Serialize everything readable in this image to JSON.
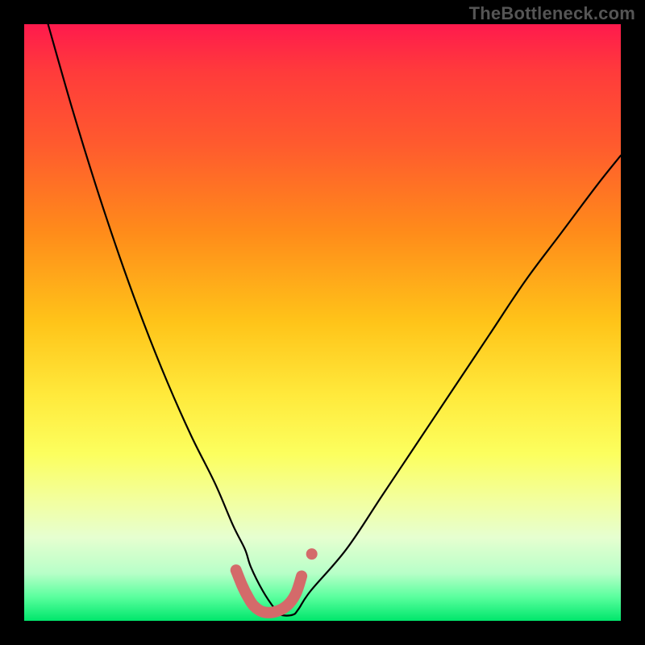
{
  "watermark": "TheBottleneck.com",
  "chart_data": {
    "type": "line",
    "title": "",
    "xlabel": "",
    "ylabel": "",
    "xlim": [
      0,
      100
    ],
    "ylim": [
      0,
      100
    ],
    "grid": false,
    "axes_shown": false,
    "legend": null,
    "annotations": [],
    "background_gradient": {
      "direction": "top-to-bottom",
      "stops": [
        {
          "pos": 0.0,
          "color": "#ff1a4d"
        },
        {
          "pos": 0.35,
          "color": "#ff8c1a"
        },
        {
          "pos": 0.62,
          "color": "#ffe93b"
        },
        {
          "pos": 0.86,
          "color": "#e6ffd0"
        },
        {
          "pos": 1.0,
          "color": "#00e66b"
        }
      ]
    },
    "series": [
      {
        "name": "bottleneck-curve",
        "stroke": "#000000",
        "x": [
          4,
          8,
          12,
          16,
          20,
          24,
          28,
          32,
          35,
          37,
          38,
          40,
          42,
          43,
          45,
          46,
          48,
          54,
          60,
          66,
          72,
          78,
          84,
          90,
          96,
          100
        ],
        "y": [
          100,
          86,
          73,
          61,
          50,
          40,
          31,
          23,
          16,
          12,
          9,
          5,
          2,
          1,
          1,
          2,
          5,
          12,
          21,
          30,
          39,
          48,
          57,
          65,
          73,
          78
        ]
      },
      {
        "name": "optimal-range-marker",
        "stroke": "#d46a6a",
        "stroke_width_px": 14,
        "x": [
          35.5,
          36.5,
          37.5,
          38.5,
          40.0,
          42.0,
          44.0,
          45.5,
          46.5
        ],
        "y": [
          8.5,
          6.0,
          4.0,
          2.5,
          1.5,
          1.5,
          2.5,
          4.5,
          7.5
        ]
      },
      {
        "name": "marker-dot",
        "type": "scatter",
        "fill": "#d46a6a",
        "radius_px": 7,
        "x": [
          48.2
        ],
        "y": [
          11.2
        ]
      }
    ]
  }
}
